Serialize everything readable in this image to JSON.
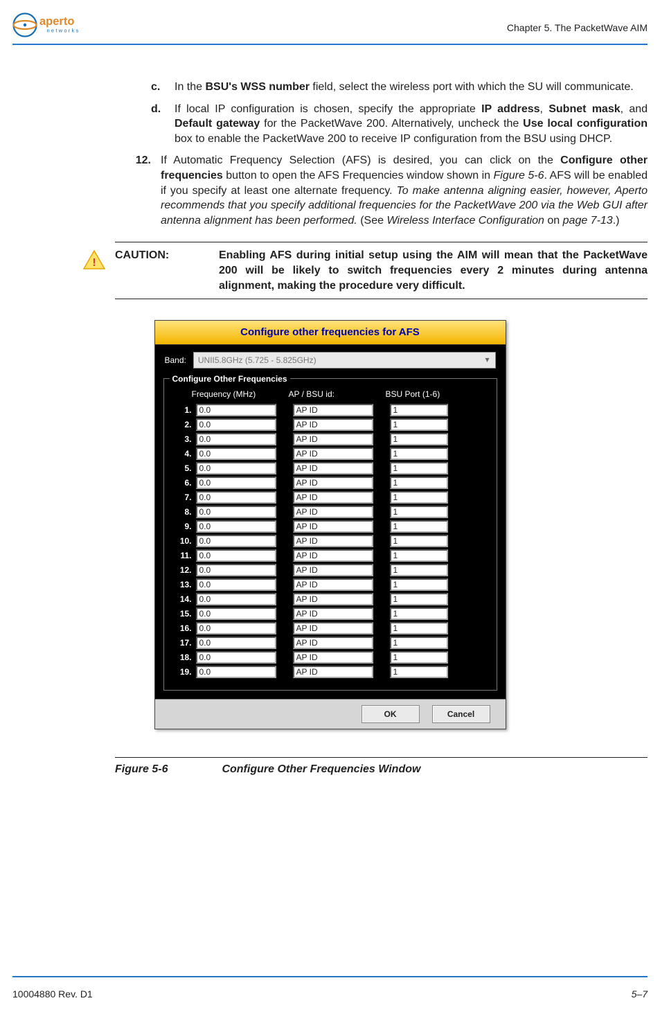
{
  "header": {
    "chapter_label": "Chapter 5.  The PacketWave AIM",
    "logo_brand": "aperto",
    "logo_sub": "networks"
  },
  "body": {
    "item_c": {
      "marker": "c.",
      "pre": "In the ",
      "b1": "BSU's WSS number",
      "post": " field, select the wireless port with which the SU will communicate."
    },
    "item_d": {
      "marker": "d.",
      "t1": "If local IP configuration is chosen, specify the appropriate ",
      "b1": "IP address",
      "t2": ", ",
      "b2": "Subnet mask",
      "t3": ", and ",
      "b3": "Default gateway",
      "t4": " for the PacketWave 200. Alternatively, uncheck the ",
      "b4": "Use local configuration",
      "t5": " box to enable the PacketWave 200 to receive IP configuration from the BSU using DHCP."
    },
    "item_12": {
      "marker": "12.",
      "t1": "If Automatic Frequency Selection (AFS) is desired, you can click on the ",
      "b1": "Configure other frequencies",
      "t2": " button to open the AFS Frequencies window shown in ",
      "i1": "Figure 5-6",
      "t3": ". AFS will be enabled if you specify at least one alternate frequency. ",
      "i2": "To make antenna aligning easier, however, Aperto recommends that you specify additional frequencies for the PacketWave 200 via the Web GUI after antenna alignment has been performed.",
      "t4": " (See ",
      "i3": "Wireless Interface Configuration",
      "t5": " on ",
      "i4": "page 7-13",
      "t6": ".)"
    },
    "caution": {
      "label": "CAUTION:",
      "text": "Enabling AFS during initial setup using the AIM will mean that the PacketWave 200 will be likely to switch frequencies every 2 minutes during antenna alignment, making the procedure very difficult."
    },
    "figure": {
      "dialog_title": "Configure other frequencies for AFS",
      "band_label": "Band:",
      "band_value": "UNII5.8GHz (5.725 - 5.825GHz)",
      "group_legend": "Configure Other Frequencies",
      "col_freq": "Frequency (MHz)",
      "col_apid": "AP / BSU  id:",
      "col_port": "BSU Port (1-6)",
      "rows": [
        {
          "n": "1.",
          "freq": "0.0",
          "ap": "AP ID",
          "port": "1"
        },
        {
          "n": "2.",
          "freq": "0.0",
          "ap": "AP ID",
          "port": "1"
        },
        {
          "n": "3.",
          "freq": "0.0",
          "ap": "AP ID",
          "port": "1"
        },
        {
          "n": "4.",
          "freq": "0.0",
          "ap": "AP ID",
          "port": "1"
        },
        {
          "n": "5.",
          "freq": "0.0",
          "ap": "AP ID",
          "port": "1"
        },
        {
          "n": "6.",
          "freq": "0.0",
          "ap": "AP ID",
          "port": "1"
        },
        {
          "n": "7.",
          "freq": "0.0",
          "ap": "AP ID",
          "port": "1"
        },
        {
          "n": "8.",
          "freq": "0.0",
          "ap": "AP ID",
          "port": "1"
        },
        {
          "n": "9.",
          "freq": "0.0",
          "ap": "AP ID",
          "port": "1"
        },
        {
          "n": "10.",
          "freq": "0.0",
          "ap": "AP ID",
          "port": "1"
        },
        {
          "n": "11.",
          "freq": "0.0",
          "ap": "AP ID",
          "port": "1"
        },
        {
          "n": "12.",
          "freq": "0.0",
          "ap": "AP ID",
          "port": "1"
        },
        {
          "n": "13.",
          "freq": "0.0",
          "ap": "AP ID",
          "port": "1"
        },
        {
          "n": "14.",
          "freq": "0.0",
          "ap": "AP ID",
          "port": "1"
        },
        {
          "n": "15.",
          "freq": "0.0",
          "ap": "AP ID",
          "port": "1"
        },
        {
          "n": "16.",
          "freq": "0.0",
          "ap": "AP ID",
          "port": "1"
        },
        {
          "n": "17.",
          "freq": "0.0",
          "ap": "AP ID",
          "port": "1"
        },
        {
          "n": "18.",
          "freq": "0.0",
          "ap": "AP ID",
          "port": "1"
        },
        {
          "n": "19.",
          "freq": "0.0",
          "ap": "AP ID",
          "port": "1"
        }
      ],
      "ok_label": "OK",
      "cancel_label": "Cancel"
    },
    "figure_caption": {
      "label": "Figure 5-6",
      "text": "Configure Other Frequencies Window"
    }
  },
  "footer": {
    "left": "10004880 Rev. D1",
    "right": "5–7"
  }
}
